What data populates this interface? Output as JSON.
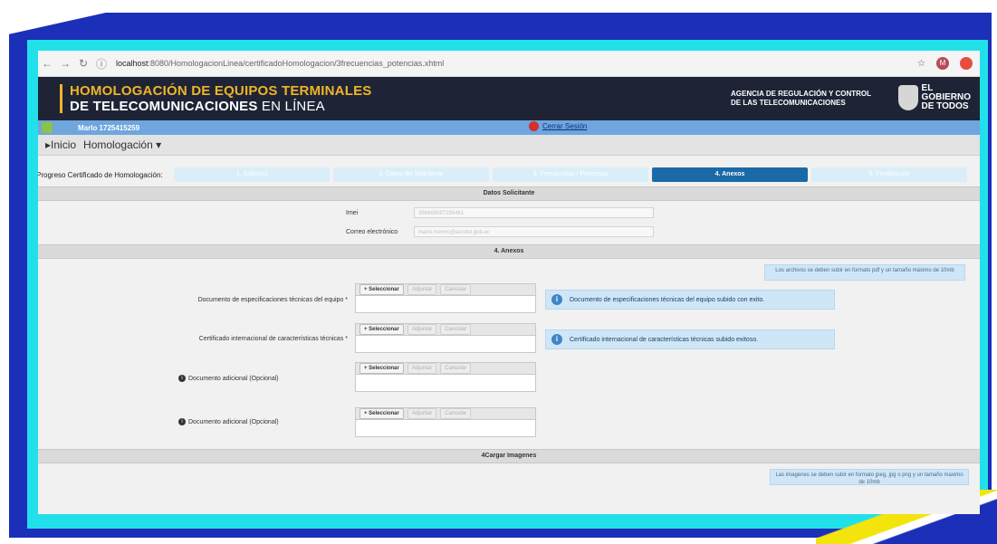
{
  "browser": {
    "url_host": "localhost",
    "url_path": ":8080/HomologacionLinea/certificadoHomologacion/3frecuencias_potencias.xhtml",
    "profile_initial": "M"
  },
  "banner": {
    "title_line1": "HOMOLOGACIÓN DE EQUIPOS TERMINALES",
    "title_line2_bold": "DE TELECOMUNICACIONES",
    "title_line2_thin": "EN LÍNEA",
    "agency_line1": "AGENCIA DE REGULACIÓN Y CONTROL",
    "agency_line2": "DE LAS TELECOMUNICACIONES",
    "gov_line1": "EL",
    "gov_line2": "GOBIERNO",
    "gov_line3": "DE TODOS"
  },
  "userbar": {
    "user": "Marlo 1725415259",
    "logout": "Cerrar Sesión"
  },
  "menu": {
    "home": "Inicio",
    "homologacion": "Homologación"
  },
  "progress": {
    "label": "Progreso Certificado de Homologación:",
    "steps": [
      "1. Solicitud",
      "2. Datos del Solicitante",
      "3. Frecuencias / Potencias",
      "4. Anexos",
      "5. Finalización"
    ],
    "active_index": 3
  },
  "datos_solicitante": {
    "header": "Datos Solicitante",
    "imei_label": "Imei",
    "imei_value": "356669087295461",
    "email_label": "Correo electrónico",
    "email_value": "marlo.merino@arcotel.gob.ec"
  },
  "anexos": {
    "header": "4. Anexos",
    "notice": "Los archivos se deben subir en formato pdf y un tamaño máximo de 10mb",
    "btn_select": "+ Seleccionar",
    "btn_upload": "Adjuntar",
    "btn_cancel": "Cancelar",
    "items": [
      {
        "label": "Documento de especificaciones técnicas del equipo *",
        "message": "Documento de especificaciones técnicas del equipo subido con exito."
      },
      {
        "label": "Certificado internacional de características técnicas *",
        "message": "Certificado internacional de características técnicas subido exitoso."
      },
      {
        "label": "Documento adicional (Opcional)",
        "message": ""
      },
      {
        "label": "Documento adicional (Opcional)",
        "message": ""
      }
    ]
  },
  "imagenes": {
    "header": "4Cargar Imagenes",
    "notice": "Las imagenes se deben subir en formato jpeg, jpg o png y un tamaño maximo de 10mb"
  },
  "colors": {
    "frame_blue": "#1b2fb8",
    "frame_cyan": "#21e0ea",
    "banner_dark": "#1e2436",
    "banner_gold": "#f0b428",
    "active_step": "#1a6aa8"
  }
}
